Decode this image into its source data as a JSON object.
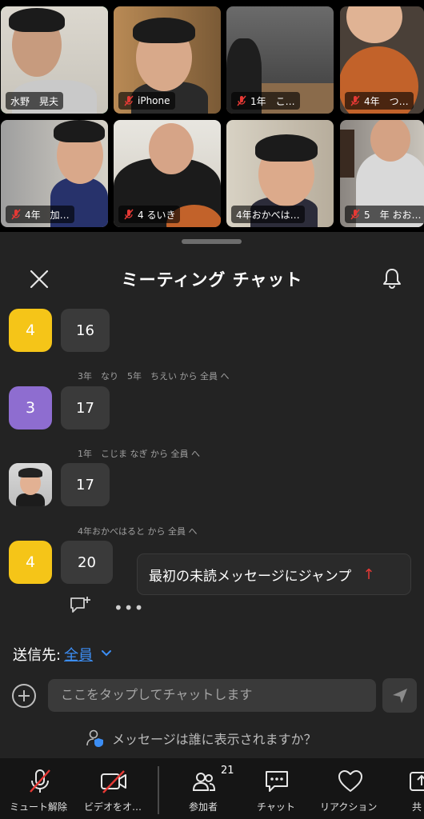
{
  "video_grid": {
    "tiles": [
      {
        "name": "水野　晃夫",
        "muted": false,
        "active": true
      },
      {
        "name": "iPhone",
        "muted": true,
        "active": false
      },
      {
        "name": "1年　こ…",
        "muted": true,
        "active": false
      },
      {
        "name": "4年　つ…",
        "muted": true,
        "active": false
      },
      {
        "name": "4年　加…",
        "muted": true,
        "active": false
      },
      {
        "name": "4 るいき",
        "muted": true,
        "active": false
      },
      {
        "name": "4年おかべは…",
        "muted": false,
        "active": false
      },
      {
        "name": "5　年 おお…",
        "muted": true,
        "active": false
      }
    ]
  },
  "chat": {
    "title": "ミーティング チャット",
    "messages": [
      {
        "sender_line": "",
        "avatar_text": "4",
        "avatar_color": "#f5c518",
        "text": "16"
      },
      {
        "sender_line": "3年　なり　5年　ちえい から 全員 へ",
        "avatar_text": "3",
        "avatar_color": "#8e6dd0",
        "text": "17"
      },
      {
        "sender_line": "1年　こじま なぎ から 全員 へ",
        "avatar_text": "",
        "avatar_color": "photo",
        "text": "17"
      },
      {
        "sender_line": "4年おかべはると から 全員 へ",
        "avatar_text": "4",
        "avatar_color": "#f5c518",
        "text": "20"
      }
    ],
    "jump_label": "最初の未読メッセージにジャンプ",
    "to_label": "送信先:",
    "to_value": "全員",
    "input_placeholder": "ここをタップしてチャットします",
    "visibility_label": "メッセージは誰に表示されますか？"
  },
  "toolbar": {
    "items": [
      {
        "label": "ミュート解除",
        "icon": "mic-off-icon"
      },
      {
        "label": "ビデオをオ…",
        "icon": "video-off-icon"
      },
      {
        "label": "参加者",
        "icon": "participants-icon",
        "badge": "21"
      },
      {
        "label": "チャット",
        "icon": "chat-icon"
      },
      {
        "label": "リアクション",
        "icon": "heart-icon"
      },
      {
        "label": "共",
        "icon": "share-icon"
      }
    ]
  },
  "colors": {
    "active_speaker": "#2fd95b",
    "link_blue": "#3c8ef5",
    "mute_red": "#e53935",
    "panel_bg": "#232323"
  }
}
